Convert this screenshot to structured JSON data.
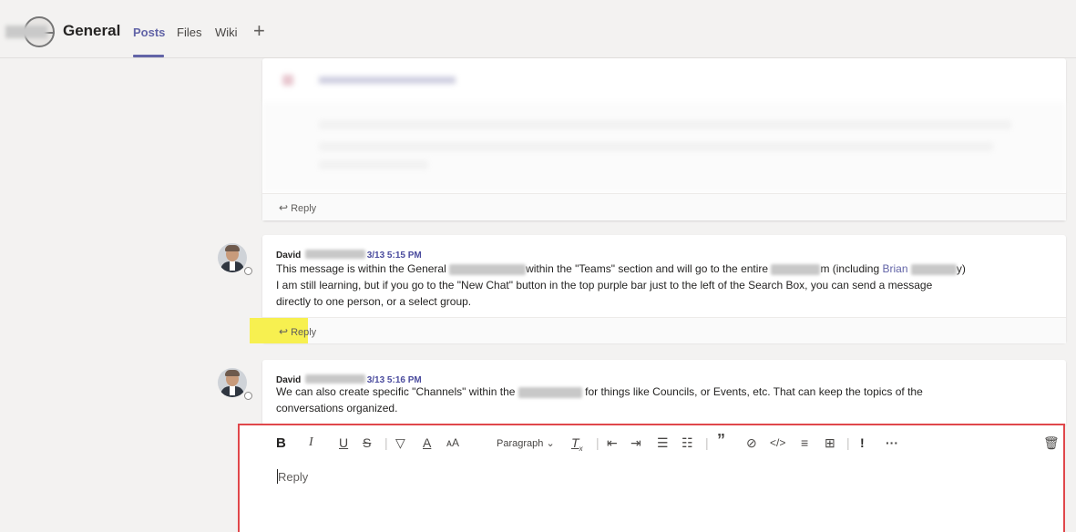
{
  "header": {
    "channel": "General",
    "tabs": [
      {
        "label": "Posts",
        "active": true
      },
      {
        "label": "Files",
        "active": false
      },
      {
        "label": "Wiki",
        "active": false
      }
    ],
    "add_tab_glyph": "+"
  },
  "thread": {
    "reply_label": "Reply",
    "messages": [
      {
        "author": "David",
        "time": "3/13 5:15 PM",
        "line1_a": "This message is within the General",
        "line1_b": "within the \"Teams\" section and will go to the entire",
        "line1_c": "m (including",
        "link_name": "Brian",
        "line1_d": "y)",
        "line2": "I am still learning, but if you go to the \"New Chat\" button in the top purple bar just to the left of the Search Box, you can send a message",
        "line3": "directly to one person, or a select group.",
        "reply_label": "Reply",
        "reply_highlight": "#f7f050"
      },
      {
        "author": "David",
        "time": "3/13 5:16 PM",
        "line1_a": "We can also create specific \"Channels\" within the",
        "line1_b": "for things like Councils, or Events, etc. That can keep the topics of the",
        "line2": "conversations organized."
      }
    ]
  },
  "editor": {
    "placeholder": "Reply",
    "paragraph_label": "Paragraph",
    "toolbar_icons": [
      "bold-icon",
      "italic-icon",
      "underline-icon",
      "strikethrough-icon",
      "highlight-icon",
      "font-color-icon",
      "font-size-icon",
      "paragraph-dropdown",
      "clear-formatting-icon",
      "decrease-indent-icon",
      "increase-indent-icon",
      "bulleted-list-icon",
      "numbered-list-icon",
      "quote-icon",
      "link-icon",
      "code-snippet-icon",
      "horizontal-rule-icon",
      "table-icon",
      "important-icon",
      "more-options-icon",
      "delete-icon"
    ],
    "border_color": "#e0474b"
  },
  "colors": {
    "accent": "#6264a7",
    "background": "#f3f2f1"
  }
}
